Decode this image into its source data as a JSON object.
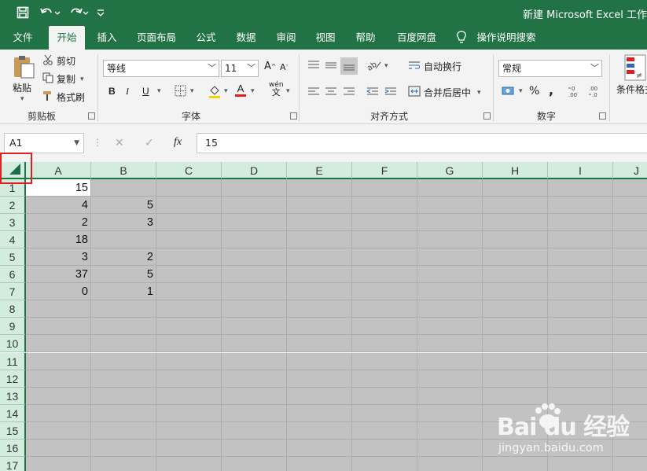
{
  "quick_access": {
    "save_icon": "save-icon",
    "undo_icon": "undo-icon",
    "redo_icon": "redo-icon",
    "customize_icon": "chevron-down-icon"
  },
  "title": "新建 Microsoft Excel 工作",
  "tabs": [
    {
      "label": "文件"
    },
    {
      "label": "开始"
    },
    {
      "label": "插入"
    },
    {
      "label": "页面布局"
    },
    {
      "label": "公式"
    },
    {
      "label": "数据"
    },
    {
      "label": "审阅"
    },
    {
      "label": "视图"
    },
    {
      "label": "帮助"
    },
    {
      "label": "百度网盘"
    }
  ],
  "active_tab": "开始",
  "tell_me": "操作说明搜索",
  "ribbon": {
    "clipboard": {
      "paste": "粘贴",
      "cut": "剪切",
      "copy": "复制",
      "format_painter": "格式刷",
      "label": "剪贴板"
    },
    "font": {
      "font_name": "等线",
      "font_size": "11",
      "bold": "B",
      "italic": "I",
      "underline": "U",
      "grow": "A",
      "shrink": "A",
      "phonetic": "wén",
      "phonetic_char": "文",
      "font_color_letter": "A",
      "label": "字体"
    },
    "alignment": {
      "wrap_text": "自动换行",
      "merge_center": "合并后居中",
      "label": "对齐方式"
    },
    "number": {
      "format": "常规",
      "percent": "%",
      "comma": ",",
      "label": "数字"
    },
    "styles": {
      "conditional": "条件格式",
      "conditional_icon": "≠"
    }
  },
  "formula_bar": {
    "name_box": "A1",
    "cancel": "✕",
    "enter": "✓",
    "fx": "fx",
    "content": "15"
  },
  "columns": [
    "A",
    "B",
    "C",
    "D",
    "E",
    "F",
    "G",
    "H",
    "I",
    "J"
  ],
  "rows": [
    "1",
    "2",
    "3",
    "4",
    "5",
    "6",
    "7",
    "8",
    "9",
    "10",
    "11",
    "12",
    "13",
    "14",
    "15",
    "16",
    "17"
  ],
  "cells": {
    "A": [
      "15",
      "4",
      "2",
      "18",
      "3",
      "37",
      "0",
      "",
      "",
      "",
      "",
      "",
      "",
      "",
      "",
      "",
      ""
    ],
    "B": [
      "",
      "5",
      "3",
      "",
      "2",
      "5",
      "1",
      "",
      "",
      "",
      "",
      "",
      "",
      "",
      "",
      "",
      ""
    ]
  },
  "watermark": {
    "brand": "Bai du 经验",
    "url": "jingyan.baidu.com"
  },
  "colors": {
    "accent": "#217346",
    "header_bg": "#d2ecdd",
    "selection": "#c2c2c2",
    "highlight_box": "#e02020"
  }
}
